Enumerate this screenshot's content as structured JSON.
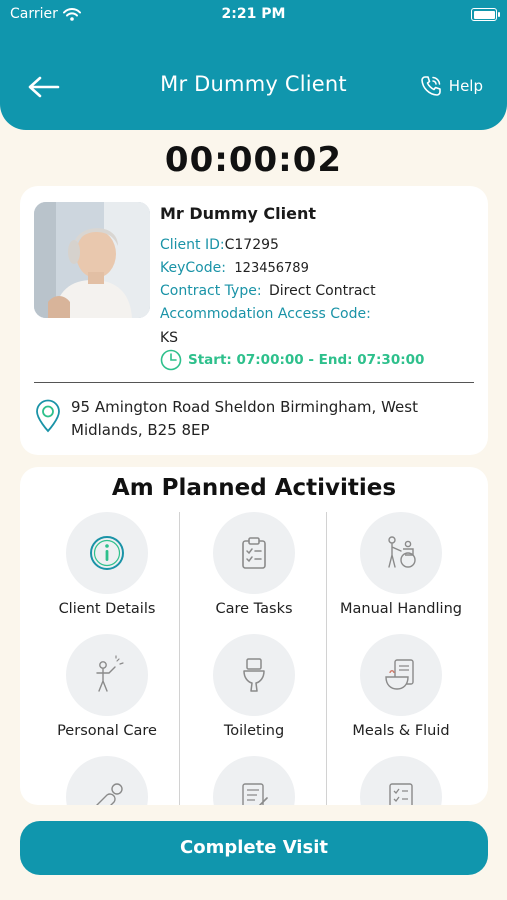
{
  "status_bar": {
    "carrier": "Carrier",
    "time": "2:21 PM"
  },
  "header": {
    "title": "Mr Dummy Client",
    "help_label": "Help"
  },
  "timer": "00:00:02",
  "client": {
    "name": "Mr Dummy Client",
    "client_id_label": "Client ID:",
    "client_id": "C17295",
    "keycode_label": "KeyCode:",
    "keycode": "123456789",
    "contract_type_label": "Contract Type:",
    "contract_type": "Direct Contract",
    "access_code_label": "Accommodation Access Code:",
    "access_code": "KS",
    "schedule": "Start: 07:00:00 - End: 07:30:00",
    "address": "95 Amington  Road Sheldon Birmingham, West Midlands, B25 8EP"
  },
  "activities": {
    "title": "Am Planned Activities",
    "items": [
      {
        "label": "Client Details",
        "icon": "info-icon"
      },
      {
        "label": "Care Tasks",
        "icon": "clipboard-icon"
      },
      {
        "label": "Manual Handling",
        "icon": "wheelchair-icon"
      },
      {
        "label": "Personal Care",
        "icon": "person-care-icon"
      },
      {
        "label": "Toileting",
        "icon": "toilet-icon"
      },
      {
        "label": "Meals & Fluid",
        "icon": "meal-icon"
      },
      {
        "label": "",
        "icon": "medication-icon"
      },
      {
        "label": "",
        "icon": "notes-icon"
      },
      {
        "label": "",
        "icon": "checklist-icon"
      }
    ]
  },
  "complete_button": "Complete Visit",
  "colors": {
    "primary": "#1096AD",
    "teal_text": "#1A93A7",
    "time_green": "#2EC08C",
    "background": "#FBF6EC"
  }
}
